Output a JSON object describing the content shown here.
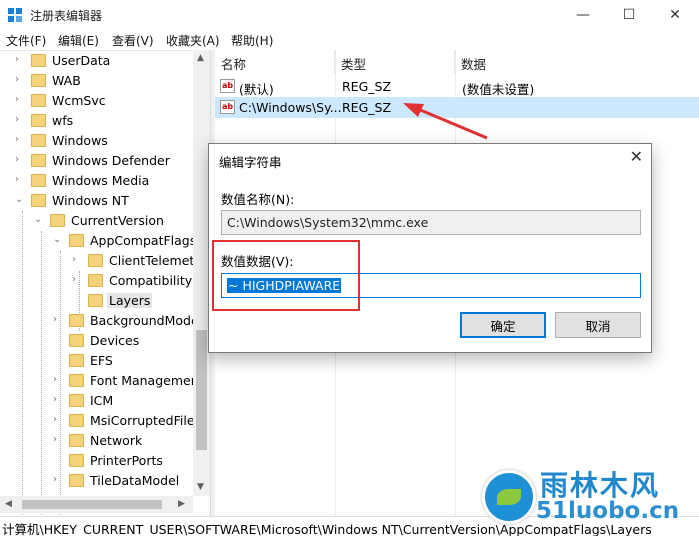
{
  "window": {
    "title": "注册表编辑器",
    "minimize_glyph": "—",
    "maximize_glyph": "☐",
    "close_glyph": "✕"
  },
  "menu": [
    "文件(F)",
    "编辑(E)",
    "查看(V)",
    "收藏夹(A)",
    "帮助(H)"
  ],
  "tree": [
    {
      "label": "UserData",
      "expander": "›"
    },
    {
      "label": "WAB",
      "expander": "›"
    },
    {
      "label": "WcmSvc",
      "expander": "›"
    },
    {
      "label": "wfs",
      "expander": "›"
    },
    {
      "label": "Windows",
      "expander": "›"
    },
    {
      "label": "Windows Defender",
      "expander": "›"
    },
    {
      "label": "Windows Media",
      "expander": "›"
    },
    {
      "label": "Windows NT",
      "expander": "⌄"
    },
    {
      "label": "CurrentVersion",
      "expander": "⌄"
    },
    {
      "label": "AppCompatFlags",
      "expander": "⌄"
    },
    {
      "label": "ClientTelemetr",
      "expander": "›"
    },
    {
      "label": "Compatibility A",
      "expander": "›"
    },
    {
      "label": "Layers",
      "expander": ""
    },
    {
      "label": "BackgroundMode",
      "expander": "›"
    },
    {
      "label": "Devices",
      "expander": ""
    },
    {
      "label": "EFS",
      "expander": ""
    },
    {
      "label": "Font Management",
      "expander": "›"
    },
    {
      "label": "ICM",
      "expander": "›"
    },
    {
      "label": "MsiCorruptedFile",
      "expander": "›"
    },
    {
      "label": "Network",
      "expander": "›"
    },
    {
      "label": "PrinterPorts",
      "expander": ""
    },
    {
      "label": "TileDataModel",
      "expander": "›"
    }
  ],
  "list": {
    "headers": [
      "名称",
      "类型",
      "数据"
    ],
    "rows": [
      {
        "name": "(默认)",
        "type": "REG_SZ",
        "data": "(数值未设置)",
        "icon": "ab"
      },
      {
        "name": "C:\\Windows\\Sy...",
        "type": "REG_SZ",
        "data": "",
        "icon": "ab"
      }
    ]
  },
  "dialog": {
    "title": "编辑字符串",
    "close_glyph": "✕",
    "name_label": "数值名称(N):",
    "name_value": "C:\\Windows\\System32\\mmc.exe",
    "data_label": "数值数据(V):",
    "data_value": "~ HIGHDPIAWARE",
    "ok_label": "确定",
    "cancel_label": "取消"
  },
  "status": {
    "path": "计算机\\HKEY_CURRENT_USER\\SOFTWARE\\Microsoft\\Windows NT\\CurrentVersion\\AppCompatFlags\\Layers"
  },
  "scroll": {
    "up": "▲",
    "down": "▼",
    "left": "◀",
    "right": "▶"
  },
  "watermark": {
    "cn": "雨林木风",
    "url": "51luobo.cn"
  },
  "colors": {
    "selection": "#cce8ff",
    "accent": "#0078d7",
    "annotation": "#e03030",
    "folder": "#f6d37a"
  }
}
